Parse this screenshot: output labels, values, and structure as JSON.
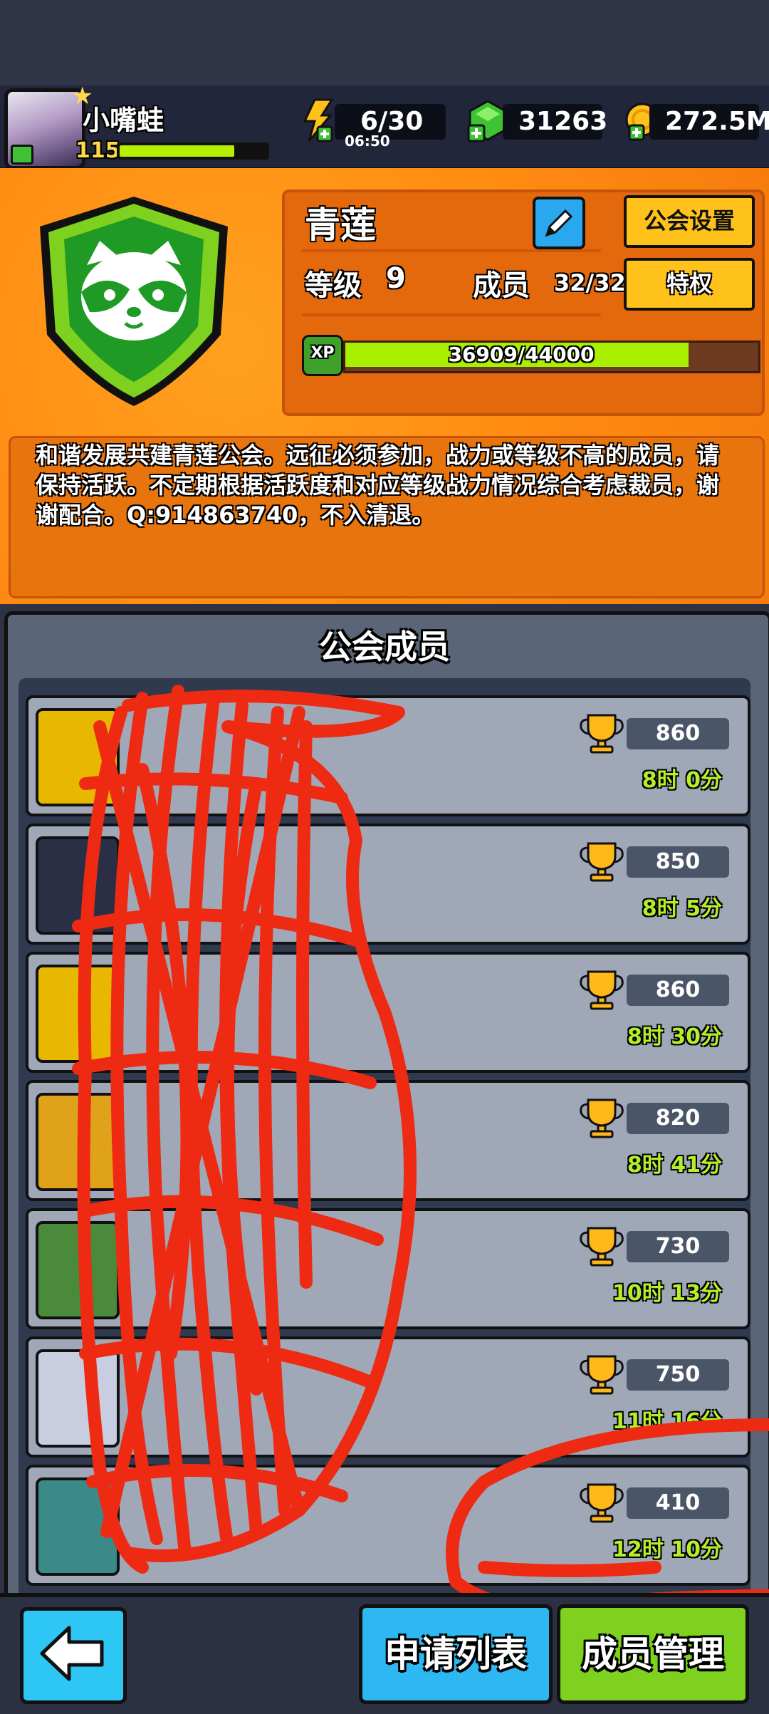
{
  "player": {
    "name": "小嘴蛙",
    "level": "115",
    "xp_fraction": 0.78
  },
  "resources": {
    "energy": "6/30",
    "energy_timer": "06:50",
    "gems": "31263",
    "coins": "272.5M"
  },
  "guild": {
    "name": "青莲",
    "settings_label": "公会设置",
    "privilege_label": "特权",
    "level_label": "等级",
    "level": "9",
    "members_label": "成员",
    "members_count": "32/32",
    "xp_icon_text": "XP",
    "xp_text": "36909/44000",
    "xp_fraction": 0.839,
    "notice": "和谐发展共建青莲公会。远征必须参加，战力或等级不高的成员，请保持活跃。不定期根据活跃度和对应等级战力情况综合考虑裁员，谢谢配合。Q:914863740，不入清退。"
  },
  "members": {
    "title": "公会成员",
    "rows": [
      {
        "score": "860",
        "time": "8时 0分"
      },
      {
        "score": "850",
        "time": "8时 5分"
      },
      {
        "score": "860",
        "time": "8时 30分"
      },
      {
        "score": "820",
        "time": "8时 41分"
      },
      {
        "score": "730",
        "time": "10时 13分"
      },
      {
        "score": "750",
        "time": "11时 16分"
      },
      {
        "score": "410",
        "time": "12时 10分"
      }
    ]
  },
  "bottom": {
    "apply_list_label": "申请列表",
    "manage_label": "成员管理"
  },
  "colors": {
    "accent_orange": "#ff8a12",
    "xp_green": "#a8f000",
    "button_yellow": "#ffc21a",
    "button_blue": "#2eb8f2",
    "button_green": "#7ed11e",
    "scribble_red": "#ee2a12"
  },
  "icons": [
    "energy-icon",
    "gem-icon",
    "coin-icon",
    "pencil-icon",
    "raccoon-emblem-icon",
    "trophy-icon",
    "back-arrow-icon"
  ]
}
